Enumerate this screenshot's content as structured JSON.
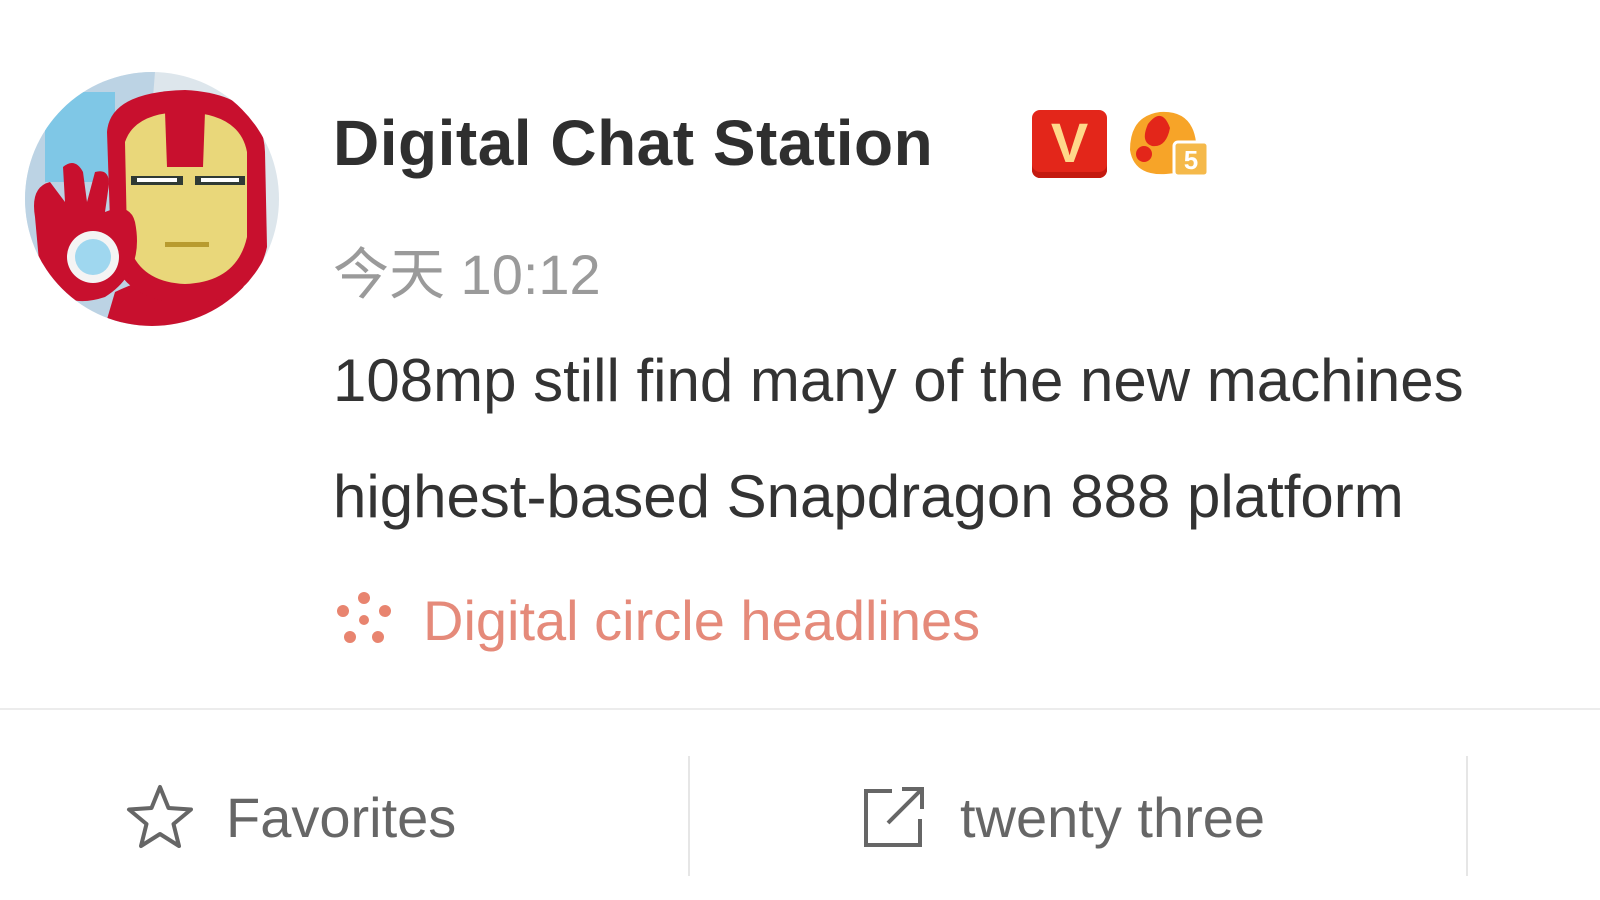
{
  "post": {
    "author": {
      "name": "Digital Chat Station",
      "verified_badge_label": "V",
      "avatar_icon": "iron-man-avatar",
      "fan_badge_icon": "fan-level-badge",
      "fan_badge_level": "5"
    },
    "timestamp": "今天 10:12",
    "content_lines": [
      "108mp still find many of the new machines",
      "highest-based Snapdragon 888 platform"
    ],
    "topic": {
      "icon": "topic-flower-icon",
      "label": "Digital circle headlines"
    }
  },
  "actions": {
    "favorite": {
      "icon": "star-icon",
      "label": "Favorites"
    },
    "share": {
      "icon": "share-icon",
      "label": "twenty three"
    }
  },
  "colors": {
    "verified": "#e3261a",
    "topic": "#e58a7a",
    "text": "#333333",
    "muted": "#9a9a9a"
  }
}
